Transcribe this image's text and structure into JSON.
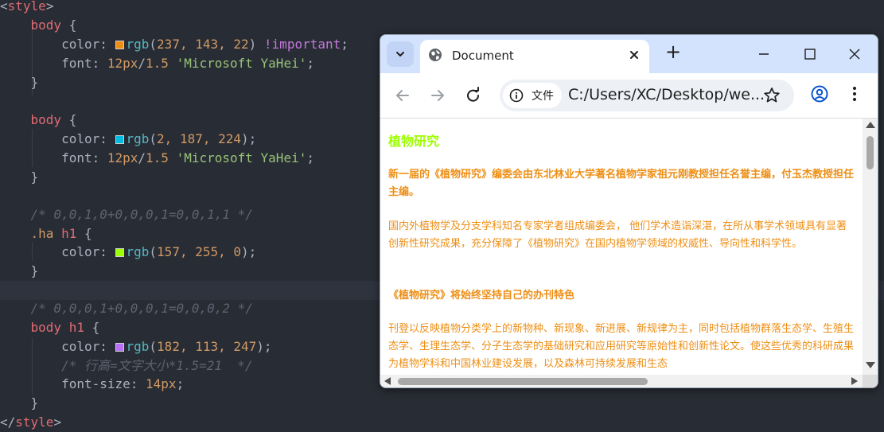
{
  "editor": {
    "l1_open": "<",
    "l1_tag": "style",
    "l1_close": ">",
    "b1_sel": "body",
    "b1_brace": " {",
    "b1_color_prop": "color",
    "colon": ": ",
    "b1_color_fn": "rgb",
    "b1_color_args_open": "(",
    "b1_color_args": "237, 143, 22",
    "b1_color_args_close": ")",
    "b1_important": " !important",
    "semi": ";",
    "b1_font_prop": "font",
    "font_size": "12px",
    "font_slash": "/",
    "font_lh": "1.5",
    "font_family": "'Microsoft YaHei'",
    "close_brace": "}",
    "b2_sel": "body",
    "b2_brace": " {",
    "b2_color_fn": "rgb",
    "b2_color_args": "2, 187, 224",
    "comment1": "/* 0,0,1,0+0,0,0,1=0,0,1,1 */",
    "b3_cls": ".ha",
    "b3_sel": " h1",
    "b3_color_args": "157, 255, 0",
    "comment2": "/* 0,0,0,1+0,0,0,1=0,0,0,2 */",
    "b4_sel_body": "body",
    "b4_sel_h1": " h1",
    "b4_color_args": "182, 113, 247",
    "comment3": "/* 行高=文字大小*1.5=21  */",
    "b4_fs_prop": "font-size",
    "b4_fs_val": "14px",
    "end_open": "</",
    "end_tag": "style",
    "end_close": ">",
    "swatches": {
      "orange": "#ed8f16",
      "cyan": "#02bbe0",
      "green": "#9dff00",
      "purple": "#b671f7"
    }
  },
  "browser": {
    "tab_title": "Document",
    "tab_icon": "globe-icon",
    "new_tab": "+",
    "chip_label": "文件",
    "url": "C:/Users/XC/Desktop/we...",
    "icons": [
      "back-arrow-icon",
      "forward-arrow-icon",
      "reload-icon",
      "info-icon",
      "star-icon",
      "profile-icon",
      "kebab-menu-icon",
      "minimize-icon",
      "maximize-icon",
      "close-icon"
    ]
  },
  "page": {
    "heading": "植物研究",
    "p1": "新一届的《植物研究》编委会由东北林业大学著名植物学家祖元刚教授担任名誉主编，付玉杰教授担任主编。",
    "p2": "国内外植物学及分支学科知名专家学者组成编委会， 他们学术造诣深湛，在所从事学术领域具有显著创新性研究成果，充分保障了《植物研究》在国内植物学领域的权威性、导向性和科学性。",
    "p3": "《植物研究》将始终坚持自己的办刊特色",
    "p4": "刊登以反映植物分类学上的新物种、新现象、新进展、新规律为主，同时包括植物群落生态学、生殖生态学、生理生态学、分子生态学的基础研究和应用研究等原始性和创新性论文。使这些优秀的科研成果为植物学科和中国林业建设发展，以及森林可持续发展和生态"
  }
}
